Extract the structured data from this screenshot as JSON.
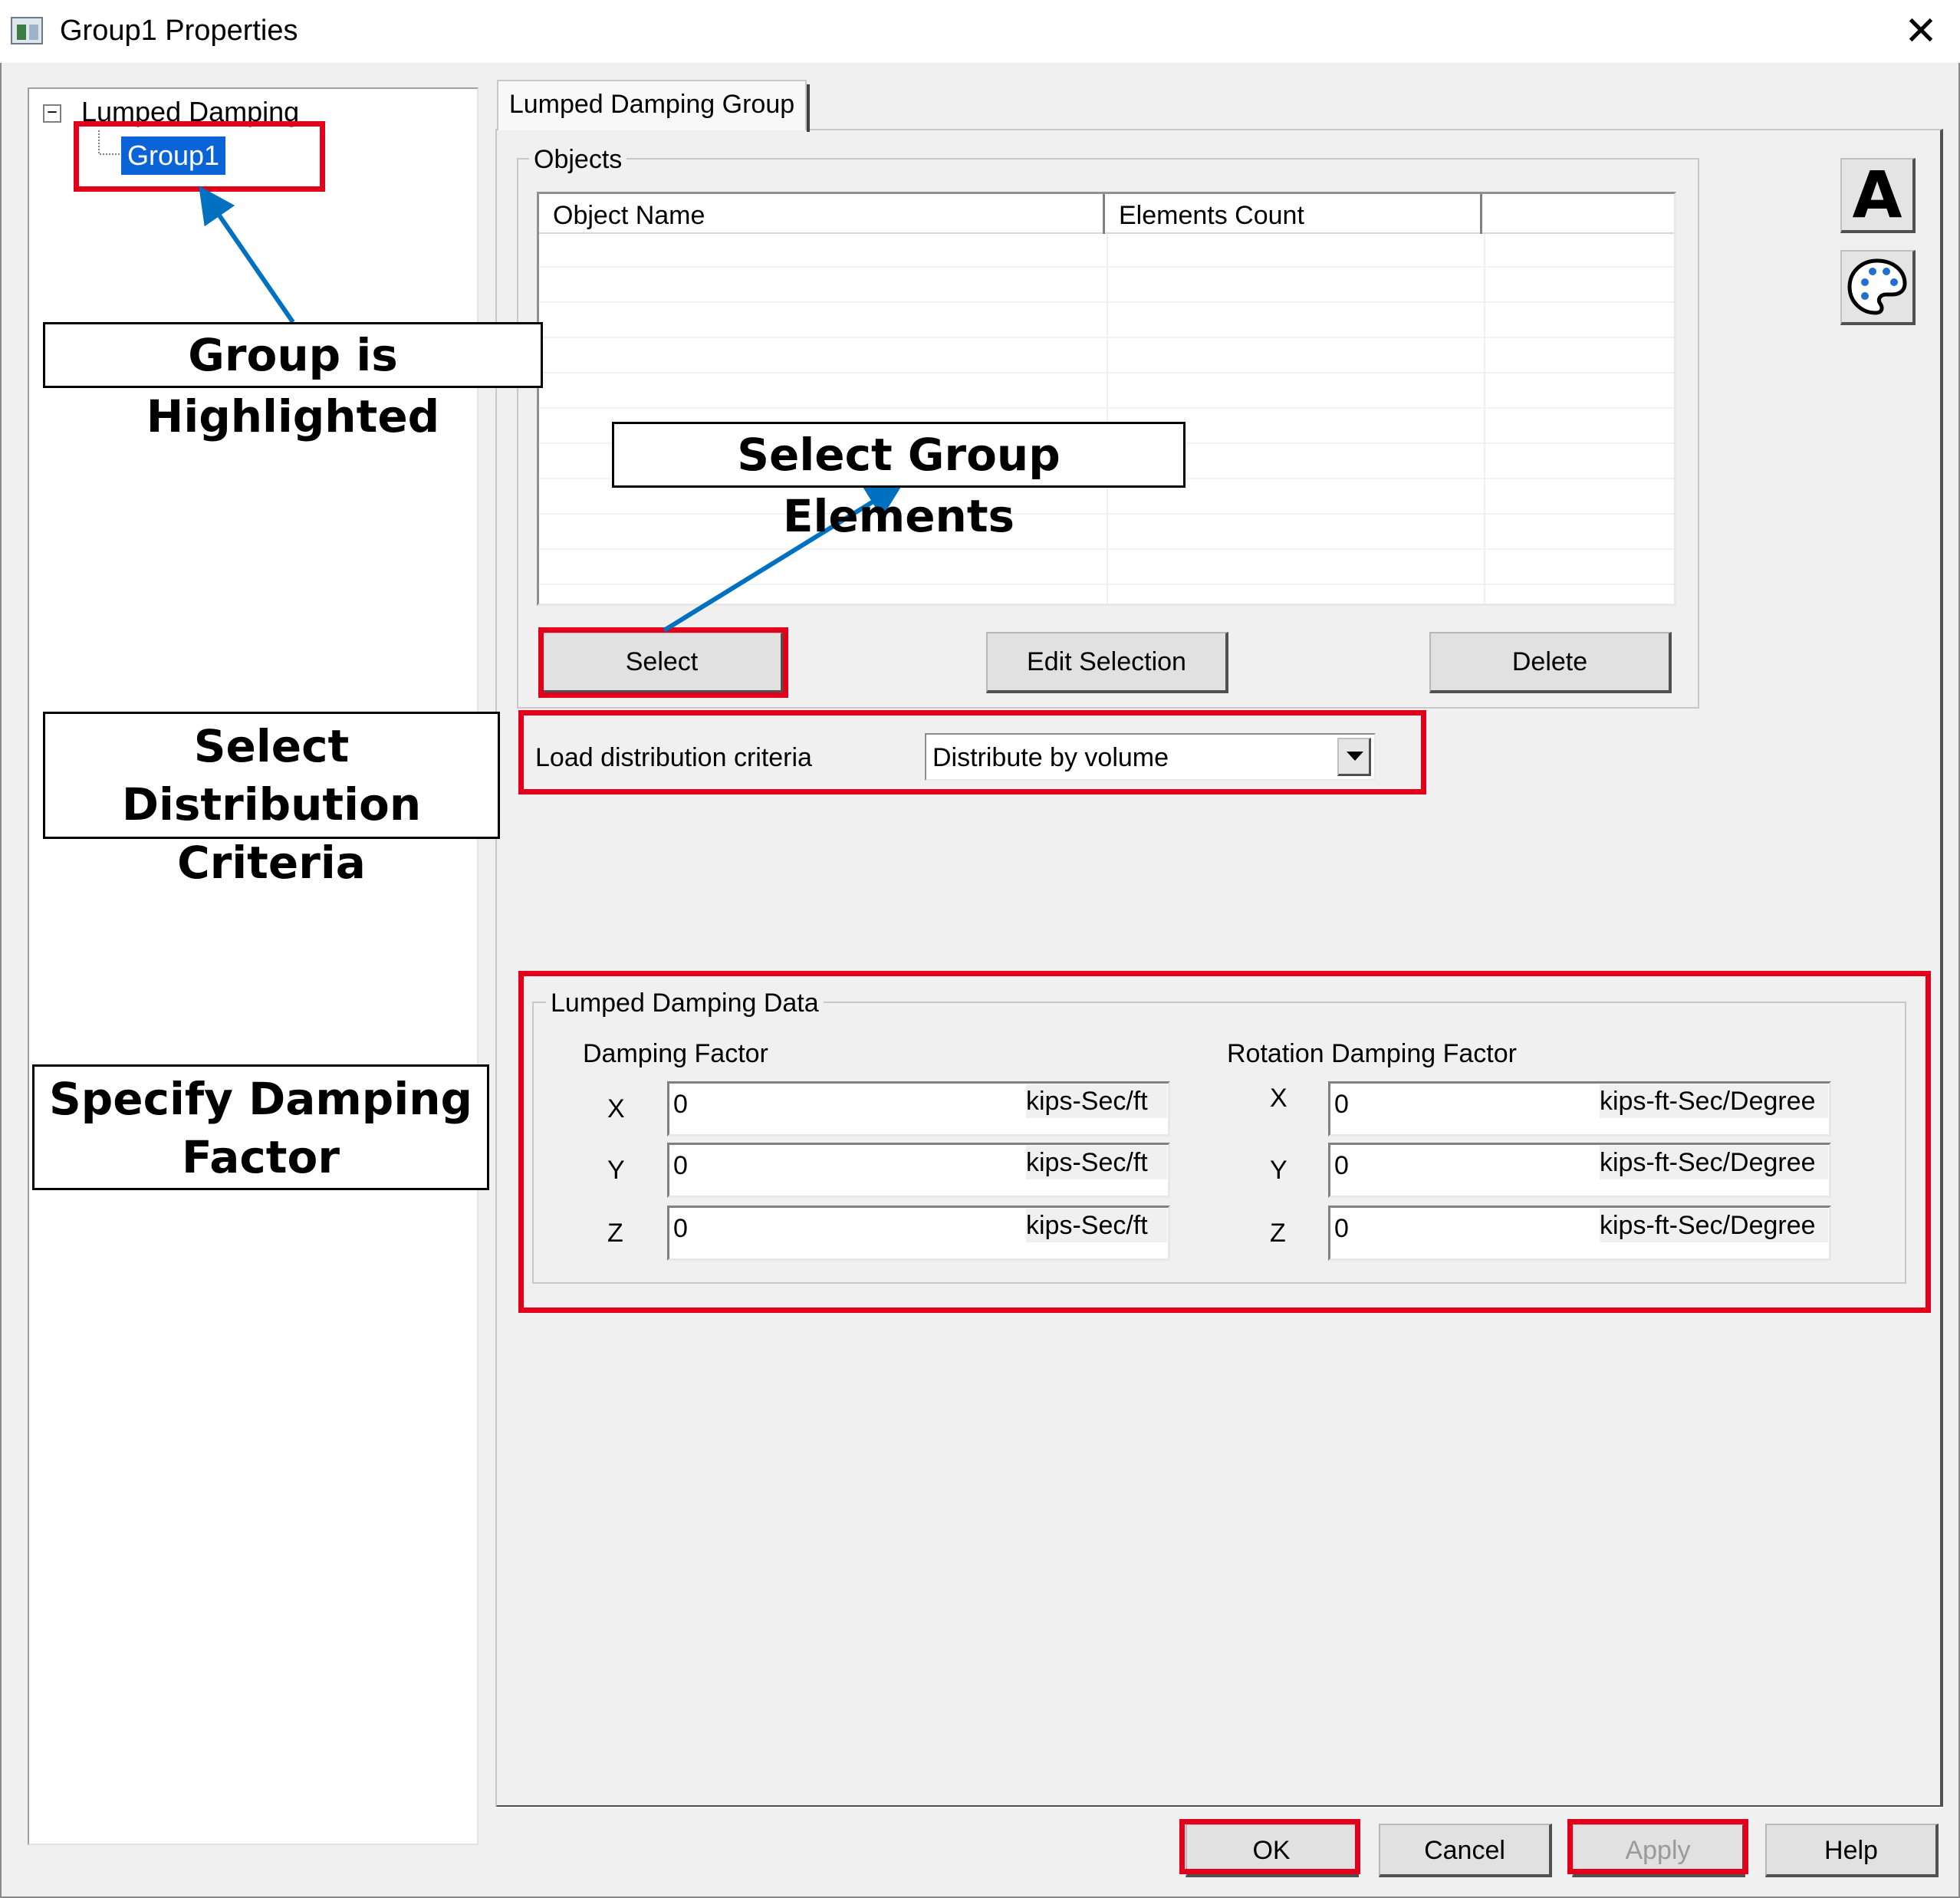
{
  "window": {
    "title": "Group1 Properties",
    "close_glyph": "✕"
  },
  "tree": {
    "root": {
      "expander": "−",
      "label": "Lumped Damping"
    },
    "child": {
      "label": "Group1",
      "selected": true
    }
  },
  "tabs": [
    {
      "label": "Lumped Damping Group",
      "active": true
    }
  ],
  "objects": {
    "group_label": "Objects",
    "columns": [
      "Object Name",
      "Elements Count",
      ""
    ],
    "rows": [],
    "buttons": {
      "select": "Select",
      "edit_selection": "Edit Selection",
      "delete": "Delete"
    }
  },
  "distribution": {
    "label": "Load distribution criteria",
    "selected": "Distribute by volume"
  },
  "lumped_damping": {
    "group_label": "Lumped Damping Data",
    "damping_factor": {
      "heading": "Damping Factor",
      "rows": [
        {
          "axis": "X",
          "value": "0",
          "unit": "kips-Sec/ft"
        },
        {
          "axis": "Y",
          "value": "0",
          "unit": "kips-Sec/ft"
        },
        {
          "axis": "Z",
          "value": "0",
          "unit": "kips-Sec/ft"
        }
      ]
    },
    "rotation_damping_factor": {
      "heading": "Rotation Damping Factor",
      "rows": [
        {
          "axis": "X",
          "value": "0",
          "unit": "kips-ft-Sec/Degree"
        },
        {
          "axis": "Y",
          "value": "0",
          "unit": "kips-ft-Sec/Degree"
        },
        {
          "axis": "Z",
          "value": "0",
          "unit": "kips-ft-Sec/Degree"
        }
      ]
    }
  },
  "side_tools": [
    {
      "icon": "font-icon",
      "glyph": "A"
    },
    {
      "icon": "palette-icon"
    }
  ],
  "footer": {
    "ok": "OK",
    "cancel": "Cancel",
    "apply": "Apply",
    "apply_enabled": false,
    "help": "Help"
  },
  "annotations": {
    "group_highlighted": "Group is Highlighted",
    "select_group_elements": "Select Group Elements",
    "select_distribution": "Select Distribution Criteria",
    "specify_damping": "Specify Damping Factor"
  },
  "colors": {
    "highlight_box": "#e3001b",
    "arrow": "#0070c0",
    "selection": "#0a64d8"
  }
}
